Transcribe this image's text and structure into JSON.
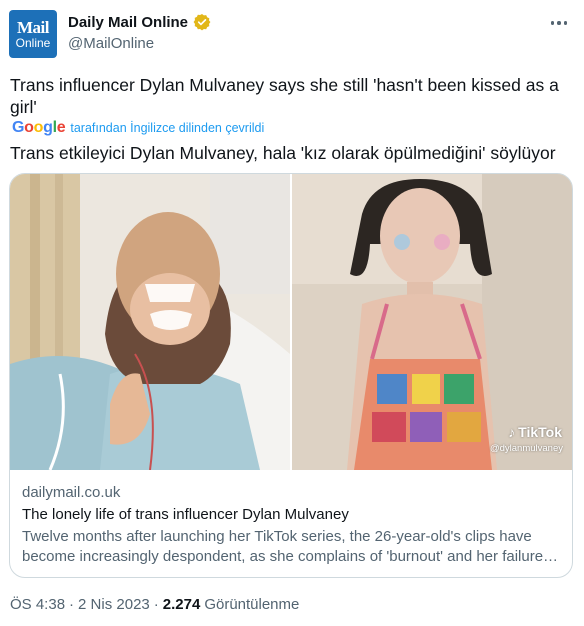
{
  "author": {
    "avatar_line1": "Mail",
    "avatar_line2": "Online",
    "display_name": "Daily Mail Online",
    "handle": "@MailOnline"
  },
  "tweet": {
    "original_text": "Trans influencer Dylan Mulvaney says she still 'hasn't been kissed as a girl'",
    "translation_provider": "Google",
    "translation_label": "tarafından İngilizce dilinden çevrildi",
    "translated_text": "Trans etkileyici Dylan Mulvaney, hala 'kız olarak öpülmediğini' söylüyor"
  },
  "card": {
    "domain": "dailymail.co.uk",
    "title": "The lonely life of trans influencer Dylan Mulvaney",
    "description": "Twelve months after launching her TikTok series, the 26-year-old's clips have become increasingly despondent, as she complains of 'burnout' and her failure to find love",
    "watermark_brand": "TikTok",
    "watermark_handle": "@dylanmulvaney"
  },
  "footer": {
    "time": "ÖS 4:38",
    "separator1": "·",
    "date": "2 Nis 2023",
    "separator2": "·",
    "views_count": "2.274",
    "views_label": "Görüntülenme"
  },
  "colors": {
    "verified_gold": "#e2b719",
    "link_blue": "#1d9bf0",
    "avatar_blue": "#1d70b8"
  },
  "icons": [
    "verified-badge-icon",
    "more-options-icon",
    "google-logo-icon",
    "tiktok-icon"
  ]
}
